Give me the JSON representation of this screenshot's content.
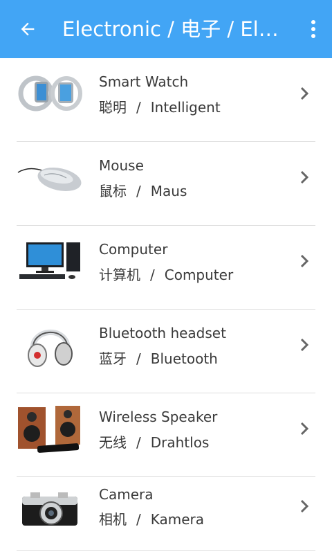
{
  "appbar": {
    "title": "Electronic / 电子 / Elek…",
    "back_icon": "arrow-back-icon",
    "menu_icon": "more-vert-icon",
    "color": "#42a5f5"
  },
  "items": [
    {
      "name": "Smart Watch",
      "zh": "聪明",
      "sep": "/",
      "de": "Intelligent",
      "image": "smart-watch-image"
    },
    {
      "name": "Mouse",
      "zh": "鼠标",
      "sep": "/",
      "de": "Maus",
      "image": "mouse-image"
    },
    {
      "name": "Computer",
      "zh": "计算机",
      "sep": "/",
      "de": "Computer",
      "image": "computer-image"
    },
    {
      "name": "Bluetooth headset",
      "zh": "蓝牙",
      "sep": "/",
      "de": "Bluetooth",
      "image": "headset-image"
    },
    {
      "name": "Wireless Speaker",
      "zh": "无线",
      "sep": "/",
      "de": "Drahtlos",
      "image": "speaker-image"
    },
    {
      "name": "Camera",
      "zh": "相机",
      "sep": "/",
      "de": "Kamera",
      "image": "camera-image"
    }
  ]
}
